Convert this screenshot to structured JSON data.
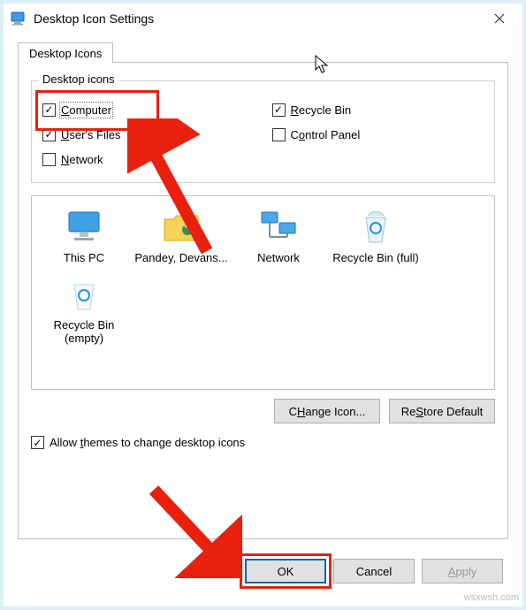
{
  "window": {
    "title": "Desktop Icon Settings"
  },
  "tab": {
    "label": "Desktop Icons"
  },
  "group": {
    "title": "Desktop icons",
    "items": [
      {
        "label_pre": "",
        "key": "C",
        "label_post": "omputer",
        "checked": true
      },
      {
        "label_pre": "",
        "key": "R",
        "label_post": "ecycle Bin",
        "checked": true
      },
      {
        "label_pre": "",
        "key": "U",
        "label_post": "ser's Files",
        "checked": true
      },
      {
        "label_pre": "C",
        "key": "o",
        "label_post": "ntrol Panel",
        "checked": false
      },
      {
        "label_pre": "",
        "key": "N",
        "label_post": "etwork",
        "checked": false
      }
    ]
  },
  "icons": [
    {
      "label": "This PC"
    },
    {
      "label": "Pandey, Devans..."
    },
    {
      "label": "Network"
    },
    {
      "label": "Recycle Bin (full)"
    },
    {
      "label": "Recycle Bin (empty)"
    }
  ],
  "buttons": {
    "change": "Change Icon...",
    "changeKey": "H",
    "restore": "Restore Default",
    "restoreKey": "S",
    "ok": "OK",
    "cancel": "Cancel",
    "apply": "Apply",
    "applyKey": "A"
  },
  "allow": {
    "checked": true,
    "pre": "Allow ",
    "key": "t",
    "post": "hemes to change desktop icons"
  },
  "watermark": "wsxwsh.com"
}
